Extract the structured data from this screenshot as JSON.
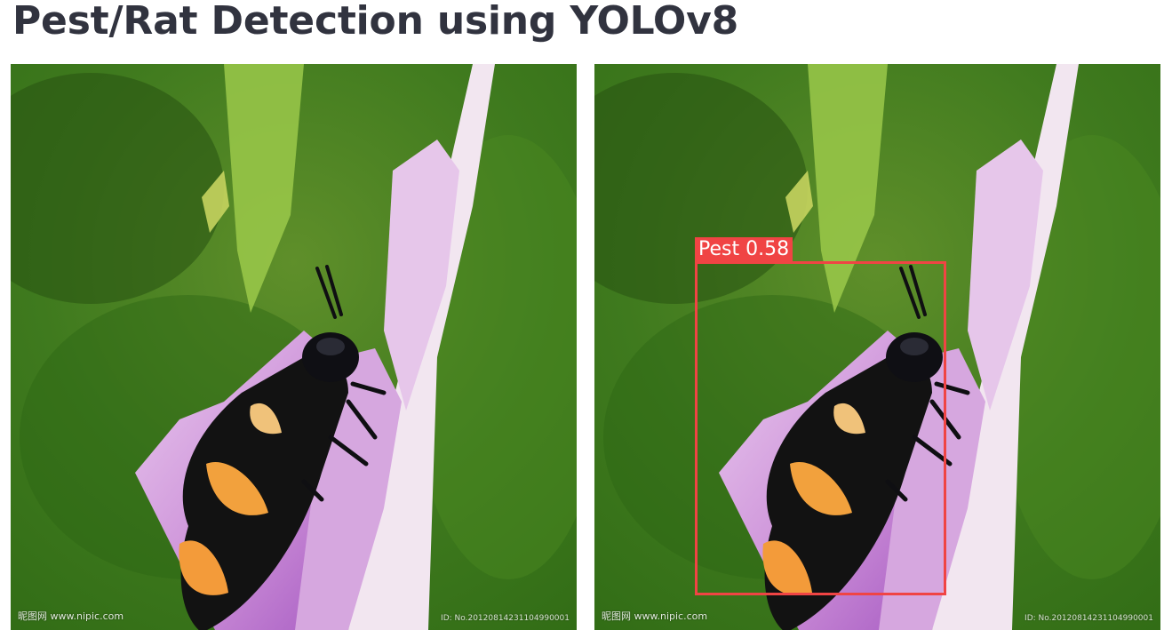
{
  "page": {
    "title": "Pest/Rat Detection using YOLOv8"
  },
  "images": {
    "original": {
      "watermark_left": "昵图网 www.nipic.com",
      "watermark_right": "ID: No.20120814231104990001"
    },
    "detected": {
      "watermark_left": "昵图网 www.nipic.com",
      "watermark_right": "ID: No.20120814231104990001",
      "detection": {
        "class_name": "Pest",
        "confidence": "0.58",
        "box_color": "#f04444"
      }
    }
  }
}
